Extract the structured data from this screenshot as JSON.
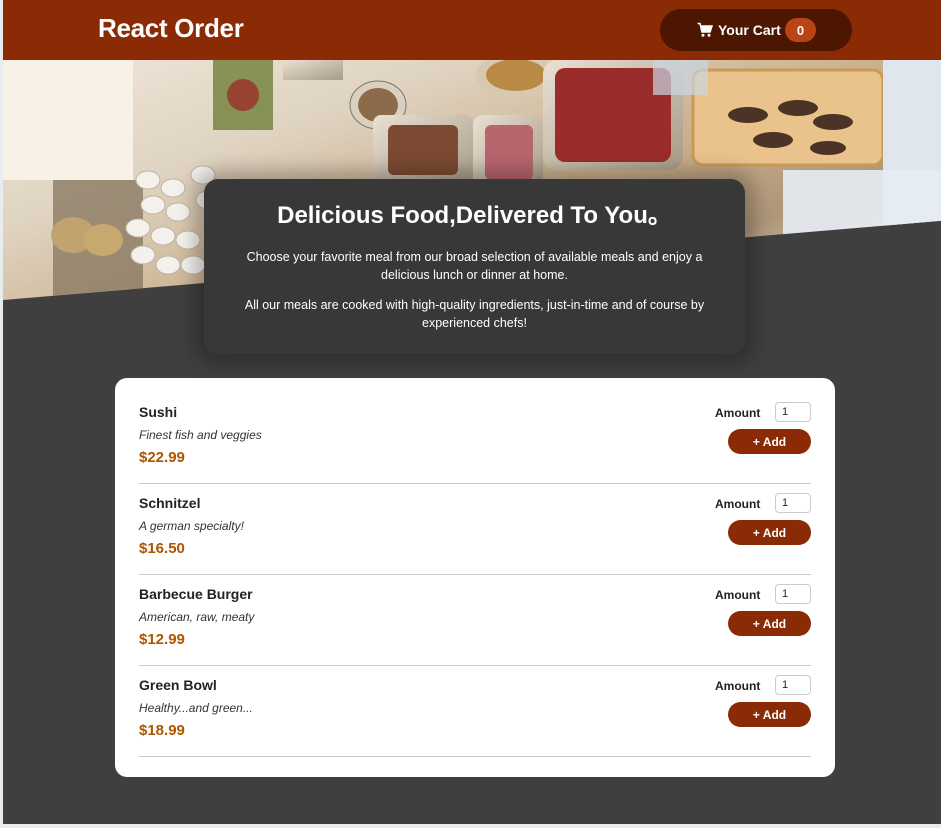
{
  "header": {
    "title": "React Order",
    "cart": {
      "label": "Your Cart",
      "count": "0",
      "icon": "cart-icon"
    }
  },
  "summary": {
    "title": "Delicious Food,Delivered To You。",
    "paragraphs": [
      "Choose your favorite meal from our broad selection of available meals and enjoy a delicious lunch or dinner at home.",
      "All our meals are cooked with high-quality ingredients, just-in-time and of course by experienced chefs!"
    ]
  },
  "meals": [
    {
      "name": "Sushi",
      "description": "Finest fish and veggies",
      "price": "$22.99",
      "amount_label": "Amount",
      "amount": "1",
      "add_label": "+ Add"
    },
    {
      "name": "Schnitzel",
      "description": "A german specialty!",
      "price": "$16.50",
      "amount_label": "Amount",
      "amount": "1",
      "add_label": "+ Add"
    },
    {
      "name": "Barbecue Burger",
      "description": "American, raw, meaty",
      "price": "$12.99",
      "amount_label": "Amount",
      "amount": "1",
      "add_label": "+ Add"
    },
    {
      "name": "Green Bowl",
      "description": "Healthy...and green...",
      "price": "$18.99",
      "amount_label": "Amount",
      "amount": "1",
      "add_label": "+ Add"
    }
  ],
  "colors": {
    "header_bg": "#8a2b06",
    "cart_bg": "#4d1601",
    "badge_bg": "#b94517",
    "page_bg": "#3f3f3f",
    "summary_bg": "#383838",
    "price": "#ad5502"
  }
}
